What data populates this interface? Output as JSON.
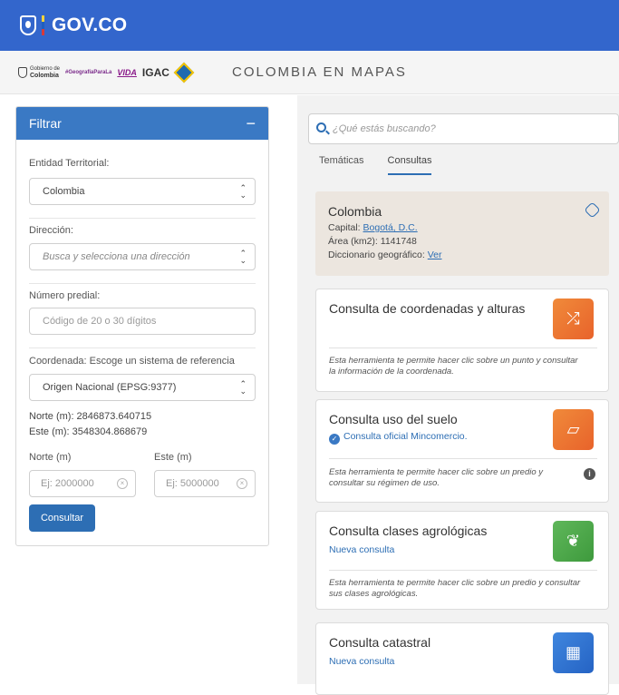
{
  "gov": {
    "brand": "GOV.CO"
  },
  "header": {
    "logo_gob_line1": "Gobierno de",
    "logo_gob_line2": "Colombia",
    "logo_geo": "#GeografíaParaLa",
    "logo_vida": "VIDA",
    "logo_igac": "IGAC",
    "site_title": "COLOMBIA EN MAPAS"
  },
  "filter": {
    "title": "Filtrar",
    "collapse": "−",
    "entidad_label": "Entidad Territorial:",
    "entidad_value": "Colombia",
    "direccion_label": "Dirección:",
    "direccion_placeholder": "Busca y selecciona una dirección",
    "predial_label": "Número predial:",
    "predial_placeholder": "Código de 20 o 30 dígitos",
    "coord_label": "Coordenada: Escoge un sistema de referencia",
    "coord_value": "Origen Nacional (EPSG:9377)",
    "norte_readout": "Norte (m): 2846873.640715",
    "este_readout": "Este (m): 3548304.868679",
    "norte_label": "Norte (m)",
    "este_label": "Este (m)",
    "norte_placeholder": "Ej: 2000000",
    "este_placeholder": "Ej: 5000000",
    "consultar": "Consultar"
  },
  "right": {
    "search_placeholder": "¿Qué estás buscando?",
    "tabs": [
      "Temáticas",
      "Consultas"
    ],
    "info": {
      "title": "Colombia",
      "capital_label": "Capital:",
      "capital_value": "Bogotá, D.C.",
      "area": "Área (km2): 1141748",
      "dic_label": "Diccionario geográfico:",
      "dic_link": "Ver"
    },
    "cards": [
      {
        "title": "Consulta de coordenadas y alturas",
        "desc": "Esta herramienta te permite hacer clic sobre un punto y consultar la información de la coordenada."
      },
      {
        "title": "Consulta uso del suelo",
        "sub": "Consulta oficial Mincomercio.",
        "desc": "Esta herramienta te permite hacer clic sobre un predio y consultar su régimen de uso."
      },
      {
        "title": "Consulta clases agrológicas",
        "sub": "Nueva consulta",
        "desc": "Esta herramienta te permite hacer clic sobre un predio y consultar sus clases agrológicas."
      },
      {
        "title": "Consulta catastral",
        "sub": "Nueva consulta"
      }
    ]
  },
  "colors": {
    "gov_blue": "#3366cc",
    "accent": "#2d6eb4",
    "orange": "#e8632b",
    "green": "#3e9a3d",
    "info_bg": "#ece6df"
  }
}
